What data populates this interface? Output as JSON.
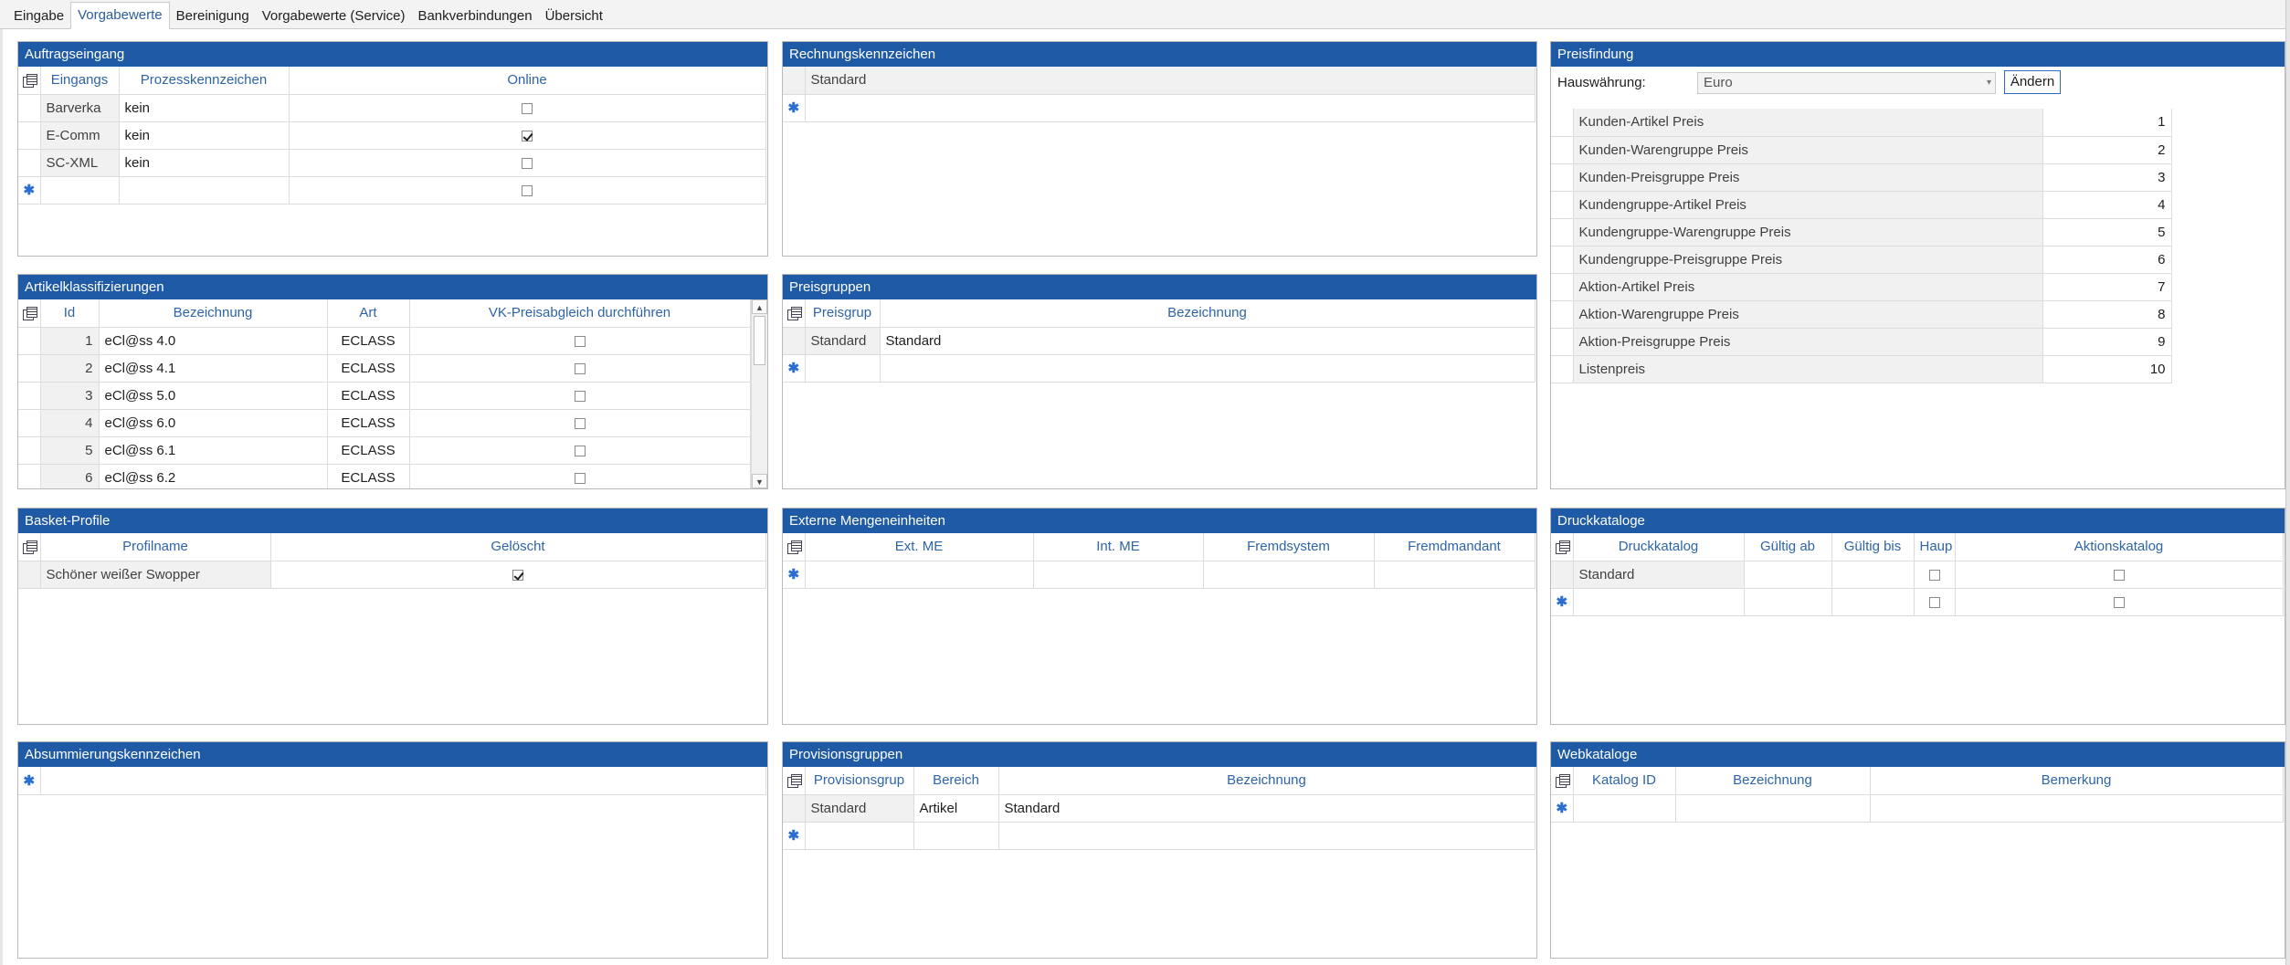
{
  "tabs": [
    "Eingabe",
    "Vorgabewerte",
    "Bereinigung",
    "Vorgabewerte (Service)",
    "Bankverbindungen",
    "Übersicht"
  ],
  "active_tab": "Vorgabewerte",
  "colors": {
    "panel_header": "#1f5aa6",
    "header_text": "#2e64a8",
    "new_row_star": "#2a6fd0"
  },
  "auftragseingang": {
    "title": "Auftragseingang",
    "columns": [
      "Eingangs",
      "Prozesskennzeichen",
      "Online"
    ],
    "rows": [
      {
        "eingang": "Barverka",
        "kennzeichen": "kein",
        "online": false
      },
      {
        "eingang": "E-Comm",
        "kennzeichen": "kein",
        "online": true
      },
      {
        "eingang": "SC-XML",
        "kennzeichen": "kein",
        "online": false
      }
    ],
    "new_row_online": false
  },
  "rechnungskennzeichen": {
    "title": "Rechnungskennzeichen",
    "rows": [
      "Standard"
    ]
  },
  "preisfindung": {
    "title": "Preisfindung",
    "hauswaehrung_label": "Hauswährung:",
    "hauswaehrung_value": "Euro",
    "aendern_label": "Ändern",
    "rows": [
      {
        "name": "Kunden-Artikel Preis",
        "rank": "1"
      },
      {
        "name": "Kunden-Warengruppe Preis",
        "rank": "2"
      },
      {
        "name": "Kunden-Preisgruppe Preis",
        "rank": "3"
      },
      {
        "name": "Kundengruppe-Artikel Preis",
        "rank": "4"
      },
      {
        "name": "Kundengruppe-Warengruppe Preis",
        "rank": "5"
      },
      {
        "name": "Kundengruppe-Preisgruppe Preis",
        "rank": "6"
      },
      {
        "name": "Aktion-Artikel Preis",
        "rank": "7"
      },
      {
        "name": "Aktion-Warengruppe Preis",
        "rank": "8"
      },
      {
        "name": "Aktion-Preisgruppe Preis",
        "rank": "9"
      },
      {
        "name": "Listenpreis",
        "rank": "10"
      }
    ]
  },
  "artikelklassifizierungen": {
    "title": "Artikelklassifizierungen",
    "columns": [
      "Id",
      "Bezeichnung",
      "Art",
      "VK-Preisabgleich durchführen"
    ],
    "rows": [
      {
        "id": "1",
        "bezeichnung": "eCl@ss 4.0",
        "art": "ECLASS",
        "vk": false
      },
      {
        "id": "2",
        "bezeichnung": "eCl@ss 4.1",
        "art": "ECLASS",
        "vk": false
      },
      {
        "id": "3",
        "bezeichnung": "eCl@ss 5.0",
        "art": "ECLASS",
        "vk": false
      },
      {
        "id": "4",
        "bezeichnung": "eCl@ss 6.0",
        "art": "ECLASS",
        "vk": false
      },
      {
        "id": "5",
        "bezeichnung": "eCl@ss 6.1",
        "art": "ECLASS",
        "vk": false
      },
      {
        "id": "6",
        "bezeichnung": "eCl@ss 6.2",
        "art": "ECLASS",
        "vk": false
      }
    ]
  },
  "preisgruppen": {
    "title": "Preisgruppen",
    "columns": [
      "Preisgrup",
      "Bezeichnung"
    ],
    "rows": [
      {
        "code": "Standard",
        "bezeichnung": "Standard"
      }
    ]
  },
  "basket_profile": {
    "title": "Basket-Profile",
    "columns": [
      "Profilname",
      "Gelöscht"
    ],
    "rows": [
      {
        "name": "Schöner weißer Swopper",
        "geloescht": true
      }
    ]
  },
  "externe_mengeneinheiten": {
    "title": "Externe Mengeneinheiten",
    "columns": [
      "Ext. ME",
      "Int. ME",
      "Fremdsystem",
      "Fremdmandant"
    ]
  },
  "druckkataloge": {
    "title": "Druckkataloge",
    "columns": [
      "Druckkatalog",
      "Gültig ab",
      "Gültig bis",
      "Haup",
      "Aktionskatalog"
    ],
    "rows": [
      {
        "name": "Standard",
        "ab": "",
        "bis": "",
        "haupt": false,
        "aktion": false
      }
    ]
  },
  "absummierungskennzeichen": {
    "title": "Absummierungskennzeichen"
  },
  "provisionsgruppen": {
    "title": "Provisionsgruppen",
    "columns": [
      "Provisionsgrup",
      "Bereich",
      "Bezeichnung"
    ],
    "rows": [
      {
        "code": "Standard",
        "bereich": "Artikel",
        "bezeichnung": "Standard"
      }
    ]
  },
  "webkataloge": {
    "title": "Webkataloge",
    "columns": [
      "Katalog ID",
      "Bezeichnung",
      "Bemerkung"
    ]
  }
}
